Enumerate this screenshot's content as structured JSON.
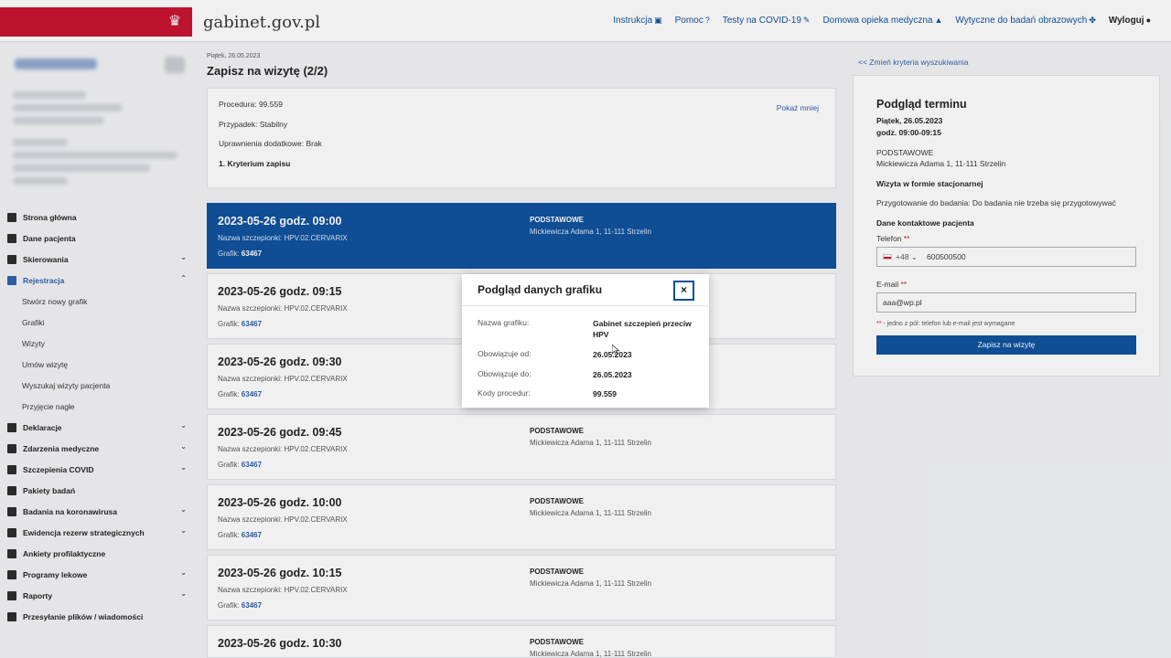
{
  "header": {
    "brand": "gabinet.gov.pl",
    "nav": [
      "Instrukcja",
      "Pomoc",
      "Testy na COVID-19",
      "Domowa opieka medyczna",
      "Wytyczne do badań obrazowych"
    ],
    "logout": "Wyloguj"
  },
  "sidebar": {
    "items": [
      {
        "label": "Strona główna",
        "icon": "grid-icon",
        "chevron": false
      },
      {
        "label": "Dane pacjenta",
        "icon": "stethoscope-icon",
        "chevron": false
      },
      {
        "label": "Skierowania",
        "icon": "document-icon",
        "chevron": true
      },
      {
        "label": "Rejestracja",
        "icon": "calendar-icon",
        "chevron": true,
        "active": true
      }
    ],
    "subitems": [
      "Stwórz nowy grafik",
      "Grafiki",
      "Wizyty",
      "Umów wizytę",
      "Wyszukaj wizyty pacjenta",
      "Przyjęcie nagłe"
    ],
    "items_after": [
      {
        "label": "Deklaracje",
        "icon": "document-icon",
        "chevron": true
      },
      {
        "label": "Zdarzenia medyczne",
        "icon": "pulse-icon",
        "chevron": true
      },
      {
        "label": "Szczepienia COVID",
        "icon": "syringe-icon",
        "chevron": true
      },
      {
        "label": "Pakiety badań",
        "icon": "document-icon",
        "chevron": false
      },
      {
        "label": "Badania na koronawirusa",
        "icon": "pen-icon",
        "chevron": true
      },
      {
        "label": "Ewidencja rezerw strategicznych",
        "icon": "box-icon",
        "chevron": true
      },
      {
        "label": "Ankiety profilaktyczne",
        "icon": "clipboard-icon",
        "chevron": false
      },
      {
        "label": "Programy lekowe",
        "icon": "pill-icon",
        "chevron": true
      },
      {
        "label": "Raporty",
        "icon": "chart-icon",
        "chevron": true
      },
      {
        "label": "Przesyłanie plików / wiadomości",
        "icon": "file-icon",
        "chevron": false
      }
    ]
  },
  "main": {
    "date": "Piątek, 26.05.2023",
    "title": "Zapisz na wizytę (2/2)",
    "summary": {
      "procedure": "Procedura: 99.559",
      "case": "Przypadek: Stabilny",
      "permissions": "Uprawnienia dodatkowe: Brak",
      "criterion": "1. Kryterium zapisu",
      "toggle": "Pokaż mniej"
    },
    "slots": [
      {
        "time": "2023-05-26 godz. 09:00",
        "vaccine": "Nazwa szczepionki: HPV.02.CERVARIX",
        "grafik_label": "Grafik:",
        "grafik_id": "63467",
        "type": "PODSTAWOWE",
        "address": "Mickiewicza Adama 1, 11-111 Strzelin",
        "selected": true
      },
      {
        "time": "2023-05-26 godz. 09:15",
        "vaccine": "Nazwa szczepionki: HPV.02.CERVARIX",
        "grafik_label": "Grafik:",
        "grafik_id": "63467",
        "type": "",
        "address": ""
      },
      {
        "time": "2023-05-26 godz. 09:30",
        "vaccine": "Nazwa szczepionki: HPV.02.CERVARIX",
        "grafik_label": "Grafik:",
        "grafik_id": "63467",
        "type": "",
        "address": ""
      },
      {
        "time": "2023-05-26 godz. 09:45",
        "vaccine": "Nazwa szczepionki: HPV.02.CERVARIX",
        "grafik_label": "Grafik:",
        "grafik_id": "63467",
        "type": "PODSTAWOWE",
        "address": "Mickiewicza Adama 1, 11-111 Strzelin"
      },
      {
        "time": "2023-05-26 godz. 10:00",
        "vaccine": "Nazwa szczepionki: HPV.02.CERVARIX",
        "grafik_label": "Grafik:",
        "grafik_id": "63467",
        "type": "PODSTAWOWE",
        "address": "Mickiewicza Adama 1, 11-111 Strzelin"
      },
      {
        "time": "2023-05-26 godz. 10:15",
        "vaccine": "Nazwa szczepionki: HPV.02.CERVARIX",
        "grafik_label": "Grafik:",
        "grafik_id": "63467",
        "type": "PODSTAWOWE",
        "address": "Mickiewicza Adama 1, 11-111 Strzelin"
      },
      {
        "time": "2023-05-26 godz. 10:30",
        "vaccine": "Nazwa szczepionki: HPV.02.CERVARIX",
        "grafik_label": "",
        "grafik_id": "",
        "type": "PODSTAWOWE",
        "address": "Mickiewicza Adama 1, 11-111 Strzelin"
      }
    ]
  },
  "right": {
    "change_link": "<< Zmień kryteria wyszukiwania",
    "title": "Podgląd terminu",
    "date": "Piątek, 26.05.2023",
    "hours": "godz. 09:00-09:15",
    "type": "PODSTAWOWE",
    "address": "Mickiewicza Adama 1, 11-111 Strzelin",
    "form": "Wizyta w formie stacjonarnej",
    "preparation": "Przygotowanie do badania: Do badania nie trzeba się przygotowywać",
    "contact_heading": "Dane kontaktowe pacjenta",
    "phone_label": "Telefon",
    "phone_prefix": "+48",
    "phone_value": "600500500",
    "email_label": "E-mail",
    "email_value": "aaa@wp.pl",
    "required_mark": "**",
    "hint": "- jedno z pól: telefon lub e-mail jest wymagane",
    "submit": "Zapisz na wizytę"
  },
  "modal": {
    "title": "Podgląd danych grafiku",
    "close": "×",
    "rows": [
      {
        "key": "Nazwa grafiku:",
        "value": "Gabinet szczepień przeciw HPV"
      },
      {
        "key": "Obowiązuje od:",
        "value": "26.05.2023"
      },
      {
        "key": "Obowiązuje do:",
        "value": "26.05.2023"
      },
      {
        "key": "Kody procedur:",
        "value": "99.559"
      }
    ]
  },
  "colors": {
    "accent": "#0b4f9c",
    "brand_red": "#c8102e",
    "link": "#2c5fa8"
  }
}
